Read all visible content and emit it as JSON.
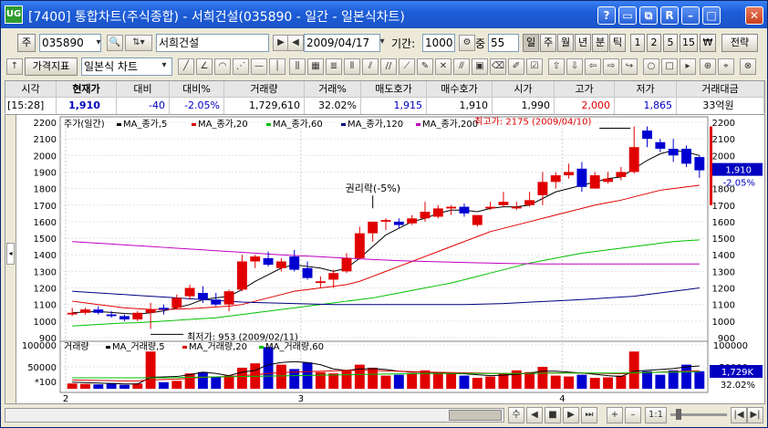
{
  "window": {
    "app_icon": "UG",
    "title": "[7400] 통합차트(주식종합) - 서희건설(035890 - 일간 - 일본식차트)",
    "controls": [
      "?",
      "▭",
      "⧉",
      "R",
      "–",
      "□",
      "✕"
    ]
  },
  "toolbar1": {
    "market_btn": "주",
    "code": "035890",
    "name": "서희건설",
    "date": "2009/04/17",
    "period_label": "기간:",
    "period_value": "1000",
    "overlap_label": "중",
    "overlap_value": "55",
    "periods": [
      "일",
      "주",
      "월",
      "년",
      "분",
      "틱",
      "1",
      "2",
      "5",
      "15",
      "₩"
    ],
    "strategy": "전략"
  },
  "toolbar2": {
    "indicator_btn": "가격지표",
    "chart_type": "일본식 차트"
  },
  "quote": {
    "headers": [
      "시각",
      "현재가",
      "대비",
      "대비%",
      "거래량",
      "거래%",
      "매도호가",
      "매수호가",
      "시가",
      "고가",
      "저가",
      "거래대금"
    ],
    "values": [
      "[15:28]",
      "1,910",
      "-40",
      "-2.05%",
      "1,729,610",
      "32.02%",
      "1,915",
      "1,910",
      "1,990",
      "2,000",
      "1,865",
      "33억원"
    ]
  },
  "price_chart": {
    "legend_title": "주가(일간)",
    "legend_items": [
      {
        "label": "MA_종가,5",
        "color": "#000000"
      },
      {
        "label": "MA_종가,20",
        "color": "#E00000"
      },
      {
        "label": "MA_종가,60",
        "color": "#00C000"
      },
      {
        "label": "MA_종가,120",
        "color": "#000080"
      },
      {
        "label": "MA_종가,200",
        "color": "#C000C0"
      }
    ],
    "annotation_high": "최고가: 2175 (2009/04/10)",
    "annotation_low": "최저가: 953 (2009/02/11)",
    "annotation_event": "권리락(-5%)",
    "current_price_tag": "1,910",
    "current_change_tag": "-2.05%",
    "colors": {
      "up": "#E00000",
      "down": "#0000D0"
    }
  },
  "volume_chart": {
    "legend_title": "거래량",
    "legend_items": [
      {
        "label": "MA_거래량,5",
        "color": "#000000"
      },
      {
        "label": "MA_거래량,20",
        "color": "#E00000"
      },
      {
        "label": "MA_거래량,60",
        "color": "#00C000"
      }
    ],
    "unit_label": "*100",
    "current_volume_tag": "1,729K",
    "current_ratio_tag": "32.02%"
  },
  "chart_data": [
    {
      "type": "candlestick",
      "title": "",
      "ylim": [
        900,
        2200
      ],
      "yticks": [
        900,
        1000,
        1100,
        1200,
        1300,
        1400,
        1500,
        1600,
        1700,
        1800,
        1900,
        2000,
        2100,
        2200
      ],
      "xticks": [
        "2",
        "3",
        "4"
      ],
      "xtick_index": [
        0,
        18,
        38
      ],
      "grid": true,
      "candles": [
        {
          "o": 1040,
          "h": 1080,
          "l": 1030,
          "c": 1050
        },
        {
          "o": 1050,
          "h": 1080,
          "l": 1040,
          "c": 1070
        },
        {
          "o": 1070,
          "h": 1090,
          "l": 1040,
          "c": 1050
        },
        {
          "o": 1040,
          "h": 1060,
          "l": 1020,
          "c": 1030
        },
        {
          "o": 1030,
          "h": 1040,
          "l": 1000,
          "c": 1010
        },
        {
          "o": 1010,
          "h": 1060,
          "l": 1000,
          "c": 1050
        },
        {
          "o": 1050,
          "h": 1110,
          "l": 953,
          "c": 1070
        },
        {
          "o": 1080,
          "h": 1100,
          "l": 1040,
          "c": 1070
        },
        {
          "o": 1080,
          "h": 1160,
          "l": 1070,
          "c": 1140
        },
        {
          "o": 1150,
          "h": 1220,
          "l": 1130,
          "c": 1200
        },
        {
          "o": 1170,
          "h": 1210,
          "l": 1110,
          "c": 1130
        },
        {
          "o": 1130,
          "h": 1170,
          "l": 1090,
          "c": 1100
        },
        {
          "o": 1100,
          "h": 1190,
          "l": 1060,
          "c": 1180
        },
        {
          "o": 1190,
          "h": 1400,
          "l": 1180,
          "c": 1360
        },
        {
          "o": 1360,
          "h": 1400,
          "l": 1320,
          "c": 1390
        },
        {
          "o": 1380,
          "h": 1420,
          "l": 1330,
          "c": 1340
        },
        {
          "o": 1320,
          "h": 1380,
          "l": 1300,
          "c": 1360
        },
        {
          "o": 1390,
          "h": 1430,
          "l": 1300,
          "c": 1310
        },
        {
          "o": 1320,
          "h": 1360,
          "l": 1250,
          "c": 1260
        },
        {
          "o": 1230,
          "h": 1270,
          "l": 1200,
          "c": 1240
        },
        {
          "o": 1250,
          "h": 1310,
          "l": 1200,
          "c": 1290
        },
        {
          "o": 1300,
          "h": 1410,
          "l": 1290,
          "c": 1380
        },
        {
          "o": 1380,
          "h": 1570,
          "l": 1370,
          "c": 1530
        },
        {
          "o": 1530,
          "h": 1600,
          "l": 1480,
          "c": 1600
        },
        {
          "o": 1600,
          "h": 1620,
          "l": 1550,
          "c": 1610
        },
        {
          "o": 1600,
          "h": 1620,
          "l": 1560,
          "c": 1580
        },
        {
          "o": 1590,
          "h": 1640,
          "l": 1580,
          "c": 1620
        },
        {
          "o": 1620,
          "h": 1720,
          "l": 1600,
          "c": 1660
        },
        {
          "o": 1630,
          "h": 1700,
          "l": 1620,
          "c": 1680
        },
        {
          "o": 1680,
          "h": 1700,
          "l": 1640,
          "c": 1690
        },
        {
          "o": 1690,
          "h": 1710,
          "l": 1630,
          "c": 1650
        },
        {
          "o": 1580,
          "h": 1640,
          "l": 1570,
          "c": 1640
        },
        {
          "o": 1680,
          "h": 1720,
          "l": 1670,
          "c": 1690
        },
        {
          "o": 1700,
          "h": 1780,
          "l": 1690,
          "c": 1720
        },
        {
          "o": 1680,
          "h": 1720,
          "l": 1670,
          "c": 1690
        },
        {
          "o": 1700,
          "h": 1780,
          "l": 1690,
          "c": 1730
        },
        {
          "o": 1760,
          "h": 1900,
          "l": 1700,
          "c": 1840
        },
        {
          "o": 1840,
          "h": 1900,
          "l": 1800,
          "c": 1880
        },
        {
          "o": 1880,
          "h": 1950,
          "l": 1860,
          "c": 1900
        },
        {
          "o": 1920,
          "h": 1960,
          "l": 1780,
          "c": 1810
        },
        {
          "o": 1800,
          "h": 1900,
          "l": 1800,
          "c": 1880
        },
        {
          "o": 1840,
          "h": 1900,
          "l": 1830,
          "c": 1860
        },
        {
          "o": 1870,
          "h": 1930,
          "l": 1850,
          "c": 1900
        },
        {
          "o": 1900,
          "h": 2175,
          "l": 1890,
          "c": 2050
        },
        {
          "o": 2150,
          "h": 2175,
          "l": 2050,
          "c": 2100
        },
        {
          "o": 2080,
          "h": 2100,
          "l": 2020,
          "c": 2040
        },
        {
          "o": 2040,
          "h": 2100,
          "l": 1960,
          "c": 2000
        },
        {
          "o": 2040,
          "h": 2060,
          "l": 1930,
          "c": 1950
        },
        {
          "o": 1990,
          "h": 2000,
          "l": 1865,
          "c": 1910
        }
      ],
      "ma_series": [
        {
          "name": "MA_종가,5",
          "values": [
            1050,
            1055,
            1058,
            1052,
            1046,
            1042,
            1050,
            1062,
            1080,
            1100,
            1130,
            1140,
            1150,
            1190,
            1240,
            1280,
            1320,
            1340,
            1330,
            1320,
            1300,
            1320,
            1380,
            1450,
            1520,
            1560,
            1600,
            1620,
            1650,
            1670,
            1670,
            1660,
            1680,
            1690,
            1690,
            1700,
            1740,
            1780,
            1800,
            1820,
            1840,
            1860,
            1870,
            1920,
            1970,
            2010,
            2030,
            2020,
            2000
          ]
        },
        {
          "name": "MA_종가,20",
          "values": [
            1120,
            1110,
            1100,
            1090,
            1080,
            1075,
            1070,
            1070,
            1072,
            1075,
            1080,
            1085,
            1090,
            1100,
            1120,
            1140,
            1160,
            1180,
            1190,
            1200,
            1210,
            1220,
            1240,
            1270,
            1300,
            1330,
            1360,
            1390,
            1420,
            1450,
            1480,
            1510,
            1540,
            1560,
            1580,
            1600,
            1620,
            1640,
            1660,
            1680,
            1700,
            1715,
            1730,
            1750,
            1770,
            1790,
            1800,
            1810,
            1820
          ]
        },
        {
          "name": "MA_종가,60",
          "values": [
            970,
            975,
            980,
            985,
            988,
            990,
            995,
            1000,
            1005,
            1010,
            1015,
            1020,
            1030,
            1040,
            1050,
            1060,
            1070,
            1080,
            1090,
            1100,
            1110,
            1120,
            1130,
            1140,
            1155,
            1170,
            1185,
            1200,
            1215,
            1230,
            1250,
            1270,
            1290,
            1310,
            1330,
            1350,
            1365,
            1380,
            1395,
            1410,
            1420,
            1430,
            1440,
            1450,
            1460,
            1470,
            1480,
            1485,
            1490
          ]
        },
        {
          "name": "MA_종가,120",
          "values": [
            1180,
            1175,
            1170,
            1165,
            1160,
            1155,
            1150,
            1145,
            1140,
            1135,
            1130,
            1125,
            1120,
            1115,
            1112,
            1110,
            1108,
            1106,
            1104,
            1102,
            1100,
            1100,
            1100,
            1100,
            1100,
            1100,
            1100,
            1100,
            1100,
            1100,
            1100,
            1102,
            1104,
            1106,
            1110,
            1114,
            1118,
            1122,
            1126,
            1130,
            1135,
            1140,
            1145,
            1150,
            1160,
            1170,
            1180,
            1190,
            1200
          ]
        },
        {
          "name": "MA_종가,200",
          "values": [
            1480,
            1475,
            1470,
            1465,
            1460,
            1455,
            1450,
            1445,
            1440,
            1435,
            1430,
            1425,
            1420,
            1415,
            1410,
            1405,
            1400,
            1396,
            1392,
            1388,
            1384,
            1380,
            1376,
            1372,
            1368,
            1365,
            1362,
            1360,
            1358,
            1356,
            1354,
            1352,
            1350,
            1348,
            1347,
            1346,
            1345,
            1345,
            1345,
            1345,
            1345,
            1345,
            1345,
            1345,
            1345,
            1345,
            1345,
            1345,
            1345
          ]
        }
      ]
    },
    {
      "type": "bar",
      "title": "",
      "ylabel": "*100",
      "ylim": [
        0,
        100000
      ],
      "yticks": [
        50000,
        100000
      ],
      "volumes": [
        12000,
        11000,
        10000,
        13000,
        9000,
        12000,
        85000,
        15000,
        18000,
        35000,
        38000,
        28000,
        30000,
        48000,
        58000,
        95000,
        55000,
        45000,
        60000,
        38000,
        35000,
        42000,
        55000,
        48000,
        30000,
        32000,
        36000,
        42000,
        38000,
        35000,
        30000,
        25000,
        28000,
        35000,
        42000,
        38000,
        50000,
        30000,
        28000,
        32000,
        25000,
        26000,
        30000,
        85000,
        40000,
        32000,
        42000,
        55000,
        40000
      ],
      "ma_series": [
        {
          "name": "MA_거래량,5",
          "values": [
            15000,
            14000,
            13000,
            12000,
            11000,
            11000,
            26000,
            27000,
            28000,
            32000,
            38000,
            35000,
            30000,
            38000,
            42000,
            55000,
            60000,
            62000,
            60000,
            55000,
            45000,
            42000,
            45000,
            46000,
            44000,
            40000,
            38000,
            38000,
            36000,
            35000,
            34000,
            32000,
            30000,
            31000,
            33000,
            36000,
            40000,
            40000,
            38000,
            36000,
            33000,
            30000,
            28000,
            40000,
            42000,
            44000,
            46000,
            50000,
            52000
          ]
        },
        {
          "name": "MA_거래량,20",
          "values": [
            20000,
            19500,
            19000,
            18500,
            18000,
            18000,
            20000,
            21000,
            22000,
            24000,
            26000,
            27000,
            28000,
            30000,
            32000,
            35000,
            37000,
            38000,
            39000,
            40000,
            41000,
            42000,
            42000,
            42000,
            41000,
            40000,
            39000,
            38000,
            37500,
            37000,
            36500,
            36000,
            35500,
            35000,
            35000,
            35000,
            35500,
            36000,
            36000,
            36000,
            35500,
            35000,
            34500,
            36000,
            37000,
            38000,
            39000,
            40000,
            41000
          ]
        },
        {
          "name": "MA_거래량,60",
          "values": [
            25000,
            25000,
            25000,
            25000,
            25000,
            25000,
            25000,
            25000,
            25500,
            26000,
            26500,
            27000,
            27500,
            28000,
            28500,
            29000,
            29500,
            30000,
            30500,
            31000,
            31500,
            32000,
            32500,
            33000,
            33500,
            34000,
            34500,
            35000,
            35000,
            35000,
            35000,
            35000,
            35000,
            35000,
            35000,
            35000,
            35500,
            36000,
            36000,
            36000,
            36000,
            36000,
            36000,
            36500,
            37000,
            37500,
            38000,
            38500,
            39000
          ]
        }
      ]
    }
  ],
  "bottom_controls": [
    "수",
    "◀",
    "■",
    "▶",
    "⏭",
    "+",
    "–",
    "1:1",
    "|◀",
    "▶|"
  ]
}
